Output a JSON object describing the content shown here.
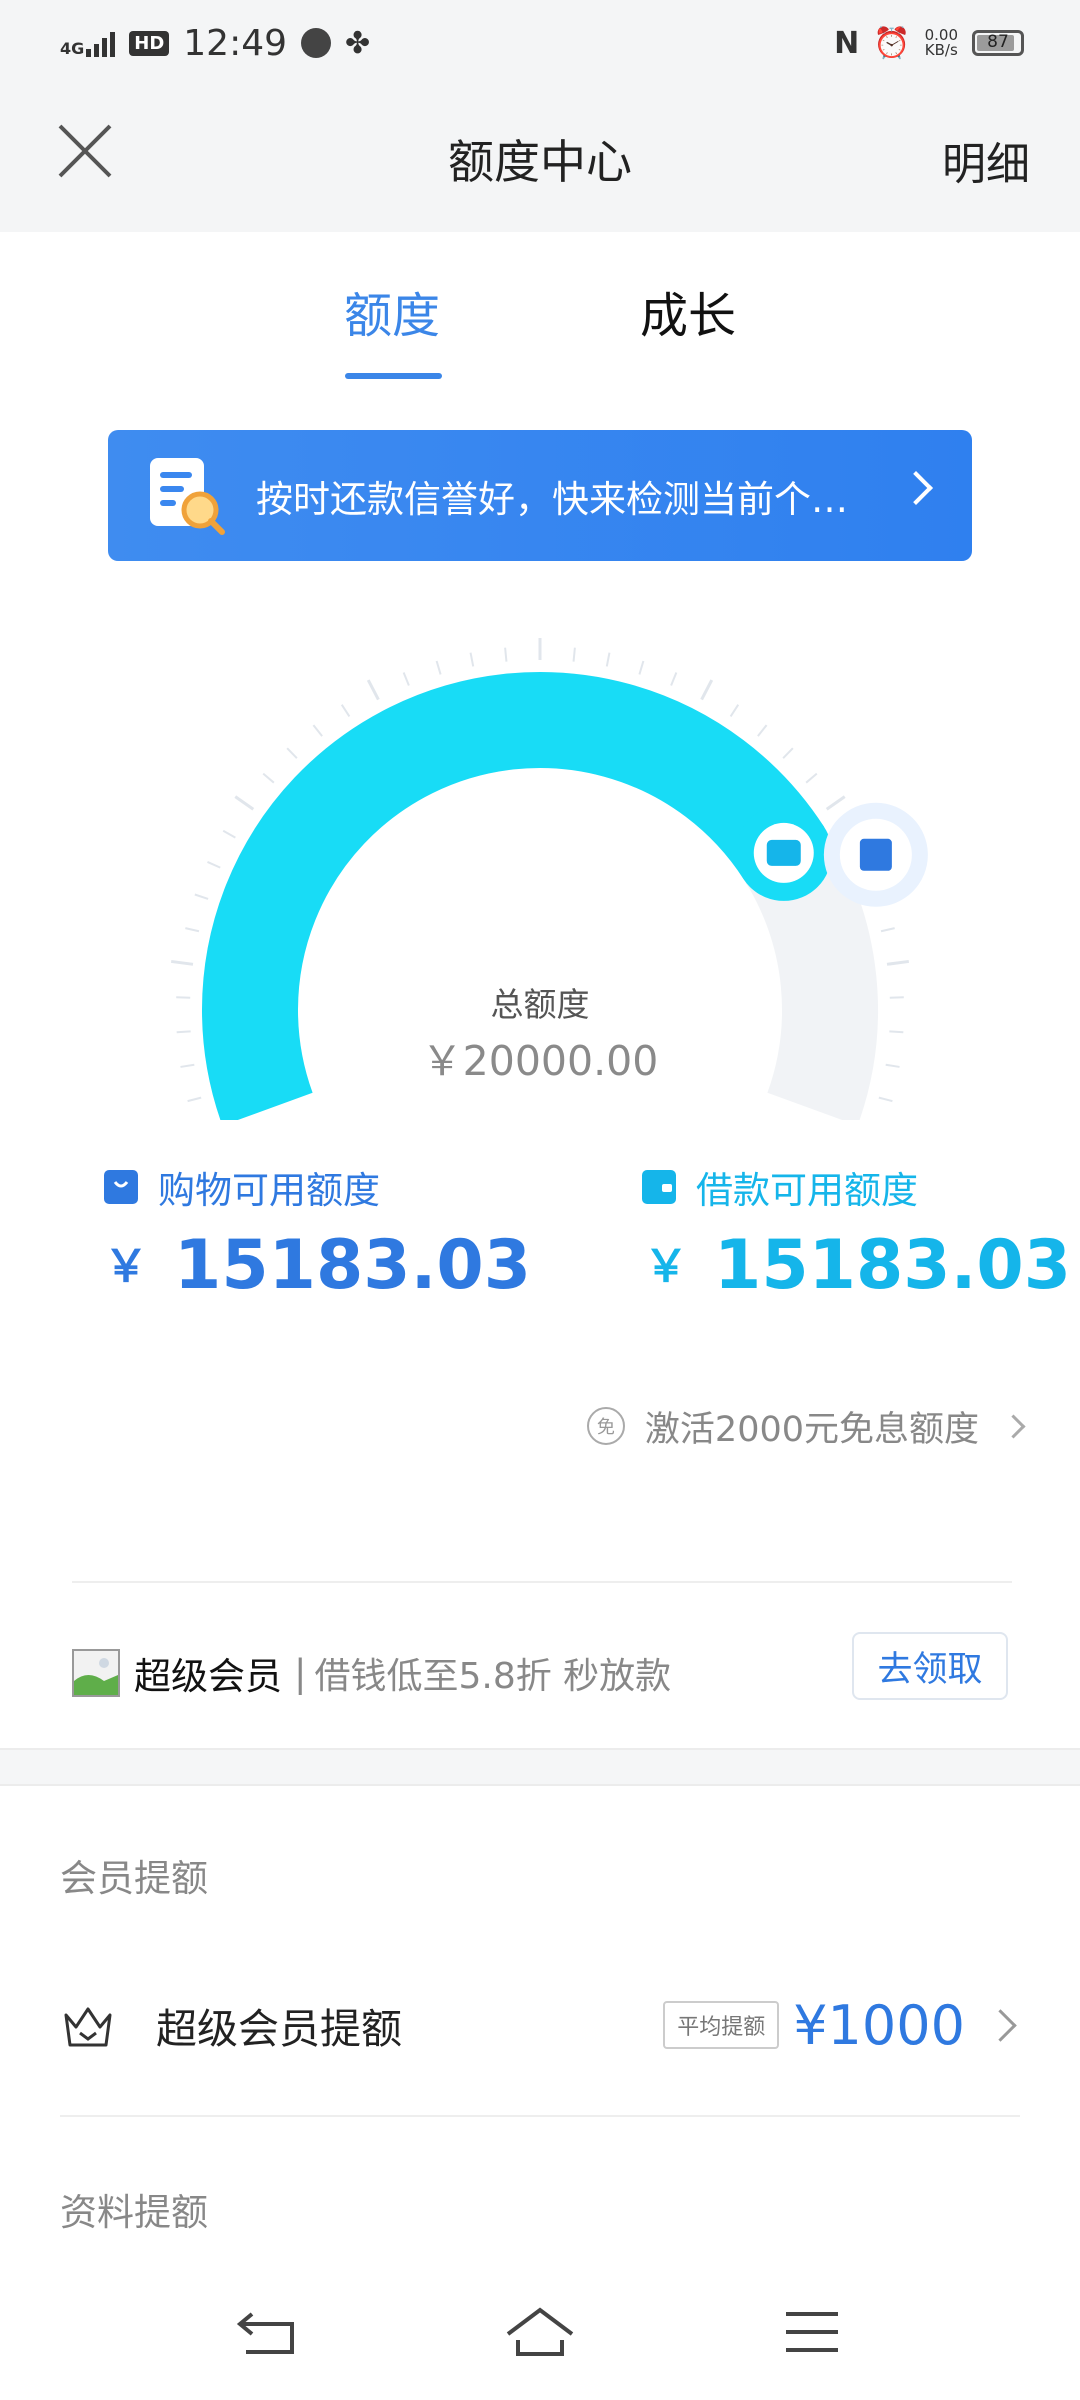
{
  "status_bar": {
    "network": "4G",
    "hd": "HD",
    "time": "12:49",
    "speed_value": "0.00",
    "speed_unit": "KB/s",
    "battery": "87",
    "battery_level": 0.87
  },
  "header": {
    "title": "额度中心",
    "detail": "明细"
  },
  "tabs": [
    {
      "label": "额度",
      "active": true
    },
    {
      "label": "成长",
      "active": false
    }
  ],
  "banner": {
    "text": "按时还款信誉好，快来检测当前个…"
  },
  "gauge": {
    "total_label": "总额度",
    "total_value": "￥20000.00",
    "used_fraction": 0.76
  },
  "quotas": {
    "shopping": {
      "label": "购物可用额度",
      "currency": "￥",
      "value": "15183.03"
    },
    "loan": {
      "label": "借款可用额度",
      "currency": "￥",
      "value": "15183.03"
    }
  },
  "activate": {
    "icon_text": "免",
    "text": "激活2000元免息额度"
  },
  "member": {
    "title": "超级会员",
    "separator": "|",
    "desc": "借钱低至5.8折 秒放款",
    "button": "去领取"
  },
  "sections": {
    "member_raise": {
      "title": "会员提额",
      "item_title": "超级会员提额",
      "badge": "平均提额",
      "amount": "¥1000"
    },
    "info_raise": {
      "title": "资料提额"
    }
  },
  "colors": {
    "accent_blue": "#2f79e0",
    "gauge_cyan": "#18dcf6",
    "banner_blue": "#3a87ef"
  },
  "icons": [
    "close-icon",
    "document-search-icon",
    "shopping-bag-icon",
    "wallet-icon",
    "crown-icon",
    "back-icon",
    "home-icon",
    "menu-icon"
  ]
}
